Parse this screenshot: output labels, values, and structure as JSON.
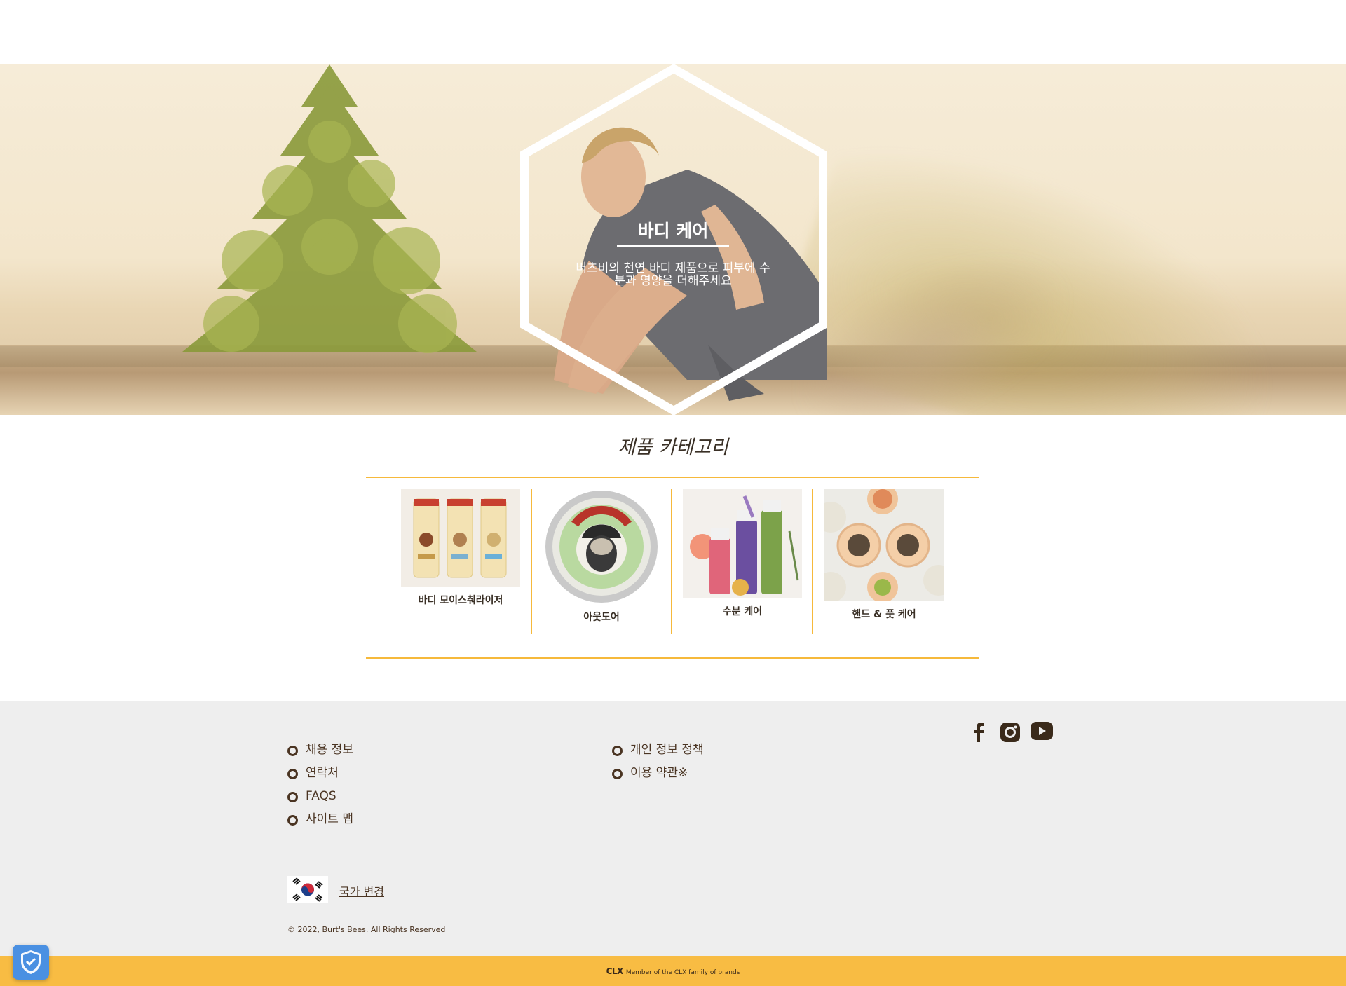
{
  "hero": {
    "title": "바디 케어",
    "description": "버츠비의 천연 바디 제품으로 피부에 수분과 영양을 더해주세요"
  },
  "categories": {
    "title": "제품 카테고리",
    "items": [
      {
        "label": "바디 모이스춰라이저"
      },
      {
        "label": "아웃도어"
      },
      {
        "label": "수분 케어"
      },
      {
        "label": "핸드 & 풋 케어"
      }
    ]
  },
  "footer": {
    "links_left": [
      "채용 정보",
      "연락처",
      "FAQS",
      "사이트 맵"
    ],
    "links_right": [
      "개인 정보 정책",
      "이용 약관※"
    ],
    "social": [
      "facebook-icon",
      "instagram-icon",
      "youtube-icon"
    ],
    "country_label": "국가 변경",
    "copyright": "© 2022, Burt's Bees. All Rights Reserved",
    "clx_logo": "CLX",
    "clx_text": "Member of the CLX family of brands"
  },
  "colors": {
    "accent": "#f6b93b",
    "footer_bg": "#eeeeee",
    "text": "#4a3422",
    "bar": "#f8bc43"
  }
}
